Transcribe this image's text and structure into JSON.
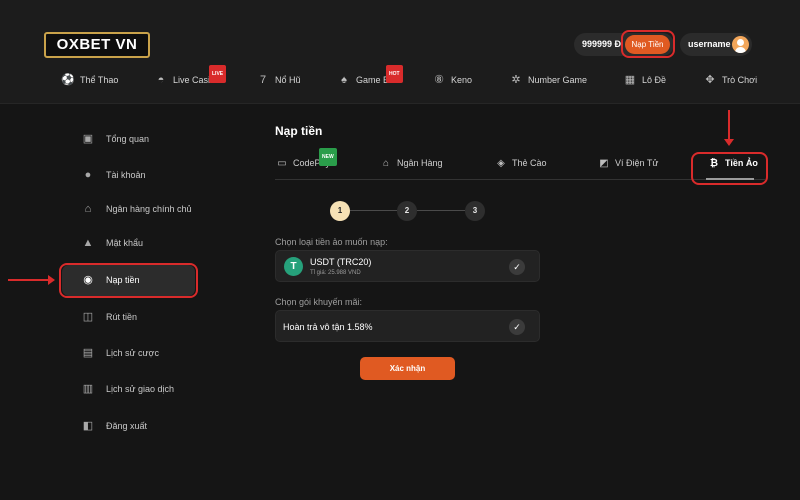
{
  "header": {
    "logo": "OXBET VN",
    "balance": "999999 Đ",
    "deposit_label": "Nạp Tiền",
    "username": "username"
  },
  "nav": {
    "items": [
      {
        "label": "Thể Thao",
        "icon": "soccer-ball-icon"
      },
      {
        "label": "Live Casino",
        "icon": "mask-icon",
        "badge": "LIVE"
      },
      {
        "label": "Nổ Hũ",
        "icon": "slot-777-icon"
      },
      {
        "label": "Game Bài",
        "icon": "spade-icon",
        "badge": "HOT"
      },
      {
        "label": "Keno",
        "icon": "keno-ball-icon"
      },
      {
        "label": "Number Game",
        "icon": "number-wheel-icon"
      },
      {
        "label": "Lô Đề",
        "icon": "lottery-icon"
      },
      {
        "label": "Trò Chơi",
        "icon": "gamepad-icon"
      }
    ]
  },
  "sidebar": {
    "items": [
      {
        "label": "Tổng quan",
        "icon": "wallet-icon"
      },
      {
        "label": "Tài khoản",
        "icon": "user-icon"
      },
      {
        "label": "Ngân hàng chính chủ",
        "icon": "bank-icon"
      },
      {
        "label": "Mật khẩu",
        "icon": "lock-icon"
      },
      {
        "label": "Nạp tiền",
        "icon": "deposit-icon",
        "active": true
      },
      {
        "label": "Rút tiền",
        "icon": "withdraw-icon"
      },
      {
        "label": "Lịch sử cược",
        "icon": "bet-history-icon"
      },
      {
        "label": "Lịch sử giao dịch",
        "icon": "transaction-history-icon"
      },
      {
        "label": "Đăng xuất",
        "icon": "logout-icon"
      }
    ]
  },
  "main": {
    "title": "Nạp tiền",
    "tabs": [
      {
        "label": "CodePay",
        "icon": "codepay-icon",
        "badge": "NEW"
      },
      {
        "label": "Ngân Hàng",
        "icon": "bank-icon"
      },
      {
        "label": "Thẻ Cào",
        "icon": "card-icon"
      },
      {
        "label": "Ví Điện Tử",
        "icon": "e-wallet-icon"
      },
      {
        "label": "Tiền Ảo",
        "icon": "bitcoin-icon",
        "active": true
      }
    ],
    "steps": [
      "1",
      "2",
      "3"
    ],
    "current_step": 1,
    "crypto_label": "Chọn loại tiền ảo muốn nạp:",
    "crypto_option": {
      "name": "USDT (TRC20)",
      "rate": "Tỉ giá: 25.988 VND",
      "coin_glyph": "T"
    },
    "promo_label": "Chọn gói khuyến mãi:",
    "promo_option": {
      "name": "Hoàn trả vô tận 1.58%"
    },
    "confirm_label": "Xác nhận"
  },
  "colors": {
    "accent": "#e05a22",
    "highlight": "#d92b2b",
    "step_active": "#f6e1b5",
    "usdt": "#26a17b"
  }
}
